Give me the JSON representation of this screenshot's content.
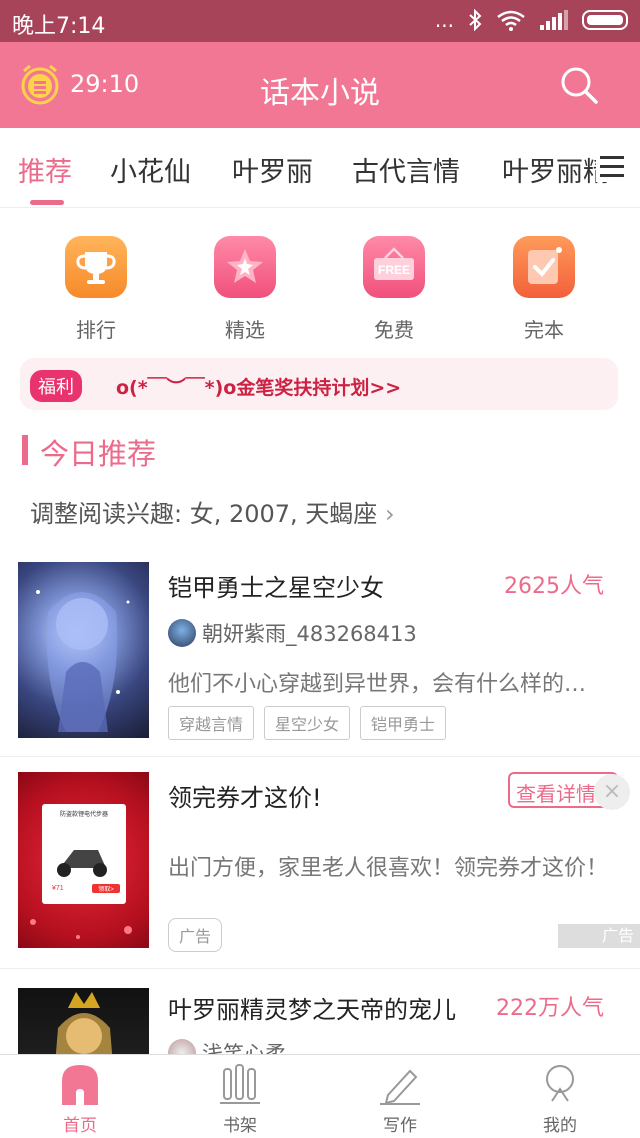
{
  "statusbar": {
    "time": "晚上7:14",
    "signal_dots": "...",
    "bluetooth_icon": "bluetooth-icon",
    "wifi_icon": "wifi-icon"
  },
  "appbar": {
    "timer": "29:10",
    "title": "话本小说"
  },
  "tabs": [
    "推荐",
    "小花仙",
    "叶罗丽",
    "古代言情",
    "叶罗丽精"
  ],
  "quick_links": [
    "排行",
    "精选",
    "免费",
    "完本"
  ],
  "free_badge": "FREE",
  "notice": {
    "badge": "福利",
    "text": "o(*￣︶￣*)o金笔奖扶持计划>>"
  },
  "section": {
    "title": "今日推荐",
    "interest": "调整阅读兴趣: 女, 2007, 天蝎座"
  },
  "cards": [
    {
      "title": "铠甲勇士之星空少女",
      "popularity": "2625人气",
      "author": "朝妍紫雨_483268413",
      "desc": "他们不小心穿越到异世界，会有什么样的故事呢",
      "tags": [
        "穿越言情",
        "星空少女",
        "铠甲勇士"
      ]
    },
    {
      "title": "领完券才这价!",
      "button": "查看详情",
      "desc": "出门方便，家里老人很喜欢！领完券才这价！",
      "tags": [
        "广告"
      ],
      "ad_label": "广告",
      "cover_text": {
        "top": "防盗款锂电代步器",
        "price": "¥71",
        "cta": "领取>"
      }
    },
    {
      "title": "叶罗丽精灵梦之天帝的宠儿",
      "popularity": "222万人气",
      "author": "浅笑心柔"
    }
  ],
  "bottom_nav": [
    "首页",
    "书架",
    "写作",
    "我的"
  ],
  "colors": {
    "primary": "#f27795",
    "accent": "#ec6b8a",
    "status": "#a8445a"
  }
}
